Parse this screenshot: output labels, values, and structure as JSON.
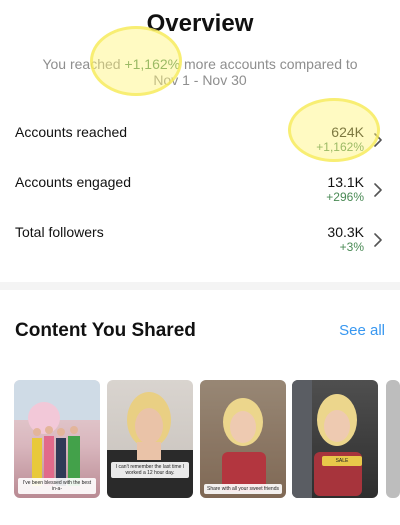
{
  "header": {
    "title": "Overview",
    "subtitle_prefix": "You reached ",
    "subtitle_pct": "+1,162%",
    "subtitle_suffix": " more accounts compared to Nov 1 - Nov 30"
  },
  "stats": [
    {
      "label": "Accounts reached",
      "value": "624K",
      "change": "+1,162%"
    },
    {
      "label": "Accounts engaged",
      "value": "13.1K",
      "change": "+296%"
    },
    {
      "label": "Total followers",
      "value": "30.3K",
      "change": "+3%"
    }
  ],
  "content": {
    "title": "Content You Shared",
    "see_all": "See all",
    "thumbnails": [
      {
        "caption": "I've been blessed with the best in-a-"
      },
      {
        "caption": "I can't remember the last time I worked a 12 hour day."
      },
      {
        "caption": "Share with all your sweet friends"
      },
      {
        "caption": "SALE"
      }
    ]
  },
  "colors": {
    "positive": "#4a8a55",
    "link": "#3897f0",
    "muted": "#8e8e8e"
  }
}
